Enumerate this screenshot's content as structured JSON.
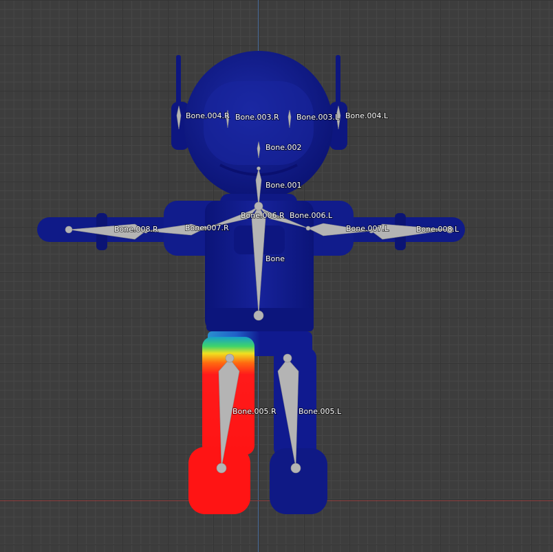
{
  "viewport": {
    "grid_color": "#3d3d3d",
    "axis_x_color": "#8a3a3a",
    "axis_y_color": "#4b6f9e"
  },
  "model": {
    "body_color": "#101a8f",
    "weight_hot_color": "#ff1a1a",
    "bone_color": "#b4b4b4"
  },
  "bones": {
    "bone_004_r": "Bone.004.R",
    "bone_003_r": "Bone.003.R",
    "bone_003_l": "Bone.003.L",
    "bone_004_l": "Bone.004.L",
    "bone_002": "Bone.002",
    "bone_001": "Bone.001",
    "bone_006_r": "Bone.006.R",
    "bone_006_l": "Bone.006.L",
    "bone_008_r": "Bone.008.R",
    "bone_007_r": "Bone.007.R",
    "bone_007_l": "Bone.007.L",
    "bone_008_l": "Bone.008.L",
    "bone": "Bone",
    "bone_005_r": "Bone.005.R",
    "bone_005_l": "Bone.005.L"
  }
}
